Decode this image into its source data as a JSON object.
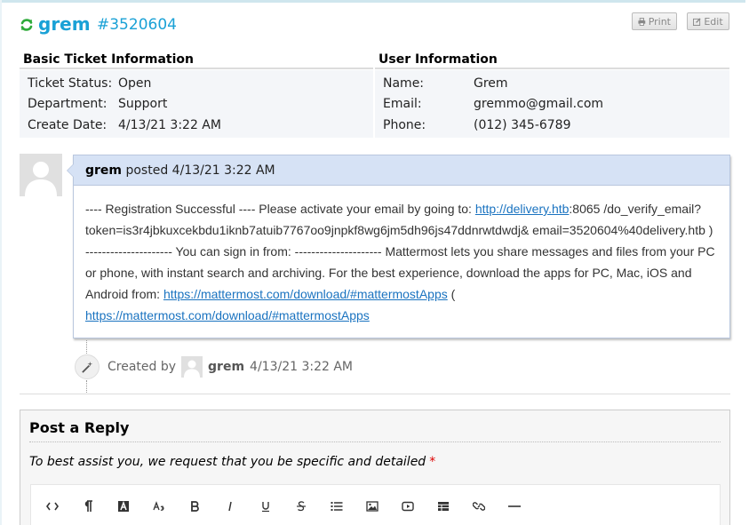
{
  "header": {
    "ticket_user": "grem",
    "ticket_number": "#3520604",
    "print_label": "Print",
    "edit_label": "Edit",
    "accent_color": "#1aa1d6"
  },
  "basic_info": {
    "title": "Basic Ticket Information",
    "rows": [
      {
        "label": "Ticket Status:",
        "value": "Open"
      },
      {
        "label": "Department:",
        "value": "Support"
      },
      {
        "label": "Create Date:",
        "value": "4/13/21 3:22 AM"
      }
    ]
  },
  "user_info": {
    "title": "User Information",
    "rows": [
      {
        "label": "Name:",
        "value": "Grem"
      },
      {
        "label": "Email:",
        "value": "gremmo@gmail.com"
      },
      {
        "label": "Phone:",
        "value": "(012) 345-6789"
      }
    ]
  },
  "thread_entry": {
    "author": "grem",
    "posted_text": "posted",
    "time": "4/13/21 3:22 AM",
    "body_1": "---- Registration Successful ---- Please activate your email by going to: ",
    "link_1": "http://delivery.htb",
    "body_2": ":8065 /do_verify_email?token=is3r4jbkuxcekbdu1iknb7atuib7767oo9jnpkf8wg6jm5dh96js47ddnrwtdwdj& email=3520604%40delivery.htb ) --------------------- You can sign in from: --------------------- Mattermost lets you share messages and files from your PC or phone, with instant search and archiving. For the best experience, download the apps for PC, Mac, iOS and Android from: ",
    "link_2": "https://mattermost.com/download/#mattermostApps",
    "body_3": " (",
    "link_3": "https://mattermost.com/download/#mattermostApps"
  },
  "event": {
    "created_by": "Created by",
    "user": "grem",
    "time": "4/13/21 3:22 AM"
  },
  "reply": {
    "title": "Post a Reply",
    "hint": "To best assist you, we request that you be specific and detailed",
    "required_mark": "*",
    "toolbar": [
      "code-view-icon",
      "paragraph-icon",
      "text-color-icon",
      "font-size-icon",
      "bold-icon",
      "italic-icon",
      "underline-icon",
      "strikethrough-icon",
      "list-icon",
      "image-icon",
      "video-icon",
      "table-icon",
      "link-icon",
      "horizontal-rule-icon"
    ]
  }
}
